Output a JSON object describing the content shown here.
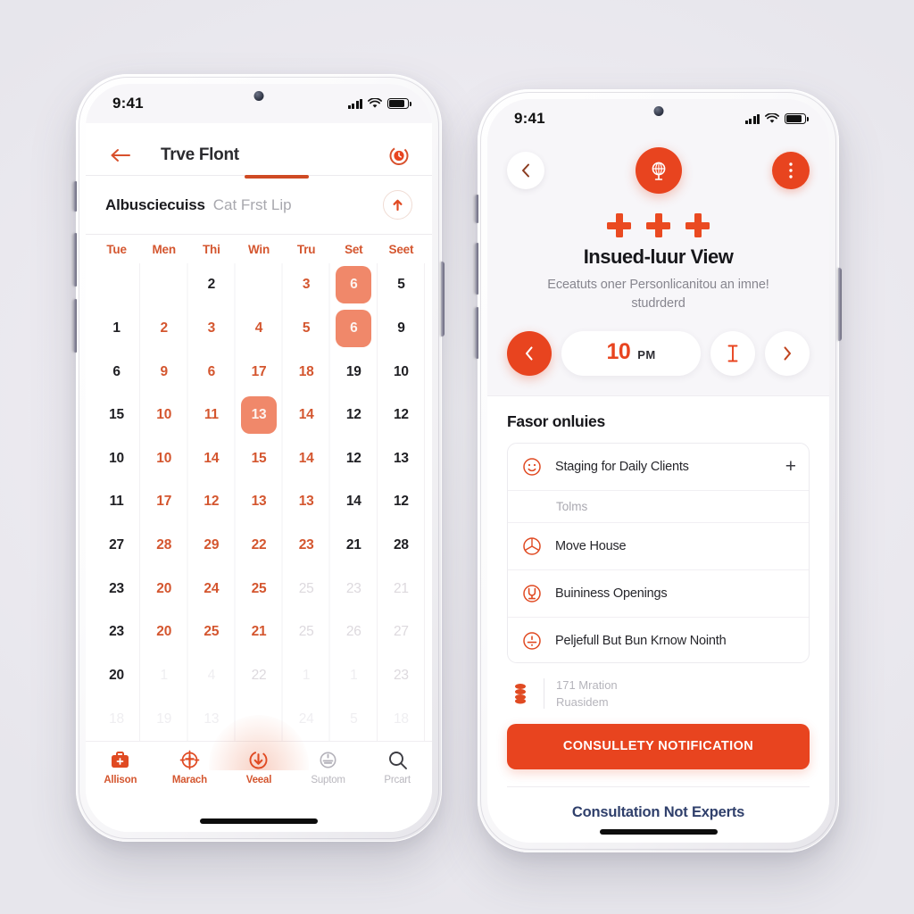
{
  "theme": {
    "brand_orange": "#e8441f",
    "brand_dark": "#d4562f",
    "highlight_salmon": "#f0886a",
    "page_background": "#edecf1",
    "link_blue": "#2f3f6b"
  },
  "left_phone": {
    "status_bar": {
      "time": "9:41",
      "signal_icon": "cellular-signal-icon",
      "wifi_icon": "wifi-icon",
      "battery_icon": "battery-icon"
    },
    "app_bar": {
      "back_icon": "back-arrow-icon",
      "title": "Trve Flont",
      "action_icon": "timer-badge-icon"
    },
    "sub_bar": {
      "title_strong": "Albusciecuiss",
      "title_muted": "Cat Frst Lip",
      "action_icon": "upload-arrow-icon"
    },
    "calendar": {
      "weekdays": [
        "Tue",
        "Men",
        "Thi",
        "Win",
        "Tru",
        "Set",
        "Seet"
      ],
      "rows": [
        [
          {
            "label": "",
            "style": "blank"
          },
          {
            "label": "",
            "style": "blank"
          },
          {
            "label": "2",
            "style": "normal"
          },
          {
            "label": "",
            "style": "blank"
          },
          {
            "label": "3",
            "style": "accent"
          },
          {
            "label": "6",
            "style": "selected"
          },
          {
            "label": "5",
            "style": "normal"
          }
        ],
        [
          {
            "label": "1",
            "style": "normal"
          },
          {
            "label": "2",
            "style": "accent"
          },
          {
            "label": "3",
            "style": "accent"
          },
          {
            "label": "4",
            "style": "accent"
          },
          {
            "label": "5",
            "style": "accent"
          },
          {
            "label": "6",
            "style": "selected"
          },
          {
            "label": "9",
            "style": "normal"
          }
        ],
        [
          {
            "label": "6",
            "style": "normal"
          },
          {
            "label": "9",
            "style": "accent"
          },
          {
            "label": "6",
            "style": "accent"
          },
          {
            "label": "17",
            "style": "accent"
          },
          {
            "label": "18",
            "style": "accent"
          },
          {
            "label": "19",
            "style": "normal"
          },
          {
            "label": "10",
            "style": "normal"
          }
        ],
        [
          {
            "label": "15",
            "style": "normal"
          },
          {
            "label": "10",
            "style": "accent"
          },
          {
            "label": "11",
            "style": "accent"
          },
          {
            "label": "13",
            "style": "selected"
          },
          {
            "label": "14",
            "style": "accent"
          },
          {
            "label": "12",
            "style": "normal"
          },
          {
            "label": "12",
            "style": "normal"
          }
        ],
        [
          {
            "label": "10",
            "style": "normal"
          },
          {
            "label": "10",
            "style": "accent"
          },
          {
            "label": "14",
            "style": "accent"
          },
          {
            "label": "15",
            "style": "accent"
          },
          {
            "label": "14",
            "style": "accent"
          },
          {
            "label": "12",
            "style": "normal"
          },
          {
            "label": "13",
            "style": "normal"
          }
        ],
        [
          {
            "label": "11",
            "style": "normal"
          },
          {
            "label": "17",
            "style": "accent"
          },
          {
            "label": "12",
            "style": "accent"
          },
          {
            "label": "13",
            "style": "accent"
          },
          {
            "label": "13",
            "style": "accent"
          },
          {
            "label": "14",
            "style": "normal"
          },
          {
            "label": "12",
            "style": "normal"
          }
        ],
        [
          {
            "label": "27",
            "style": "normal"
          },
          {
            "label": "28",
            "style": "accent"
          },
          {
            "label": "29",
            "style": "accent"
          },
          {
            "label": "22",
            "style": "accent"
          },
          {
            "label": "23",
            "style": "accent"
          },
          {
            "label": "21",
            "style": "normal"
          },
          {
            "label": "28",
            "style": "normal"
          }
        ],
        [
          {
            "label": "23",
            "style": "normal"
          },
          {
            "label": "20",
            "style": "accent"
          },
          {
            "label": "24",
            "style": "accent"
          },
          {
            "label": "25",
            "style": "accent"
          },
          {
            "label": "25",
            "style": "dim"
          },
          {
            "label": "23",
            "style": "dim"
          },
          {
            "label": "21",
            "style": "dim"
          }
        ],
        [
          {
            "label": "23",
            "style": "normal"
          },
          {
            "label": "20",
            "style": "accent"
          },
          {
            "label": "25",
            "style": "accent"
          },
          {
            "label": "21",
            "style": "accent"
          },
          {
            "label": "25",
            "style": "dim"
          },
          {
            "label": "26",
            "style": "dim"
          },
          {
            "label": "27",
            "style": "dim"
          }
        ],
        [
          {
            "label": "20",
            "style": "normal"
          },
          {
            "label": "1",
            "style": "faint"
          },
          {
            "label": "4",
            "style": "faint"
          },
          {
            "label": "22",
            "style": "dim"
          },
          {
            "label": "1",
            "style": "faint"
          },
          {
            "label": "1",
            "style": "faint"
          },
          {
            "label": "23",
            "style": "dim"
          }
        ],
        [
          {
            "label": "18",
            "style": "faint"
          },
          {
            "label": "19",
            "style": "faint"
          },
          {
            "label": "13",
            "style": "faint"
          },
          {
            "label": "",
            "style": "blank"
          },
          {
            "label": "24",
            "style": "faint"
          },
          {
            "label": "5",
            "style": "faint"
          },
          {
            "label": "18",
            "style": "faint"
          }
        ]
      ]
    },
    "tab_bar": [
      {
        "label": "Allison",
        "icon": "briefcase-icon",
        "active": true
      },
      {
        "label": "Marach",
        "icon": "target-crosshair-icon",
        "active": true
      },
      {
        "label": "Veeal",
        "icon": "download-circle-icon",
        "active": true
      },
      {
        "label": "Suptom",
        "icon": "support-circle-icon",
        "active": false
      },
      {
        "label": "Prcart",
        "icon": "search-icon",
        "active": false
      }
    ]
  },
  "right_phone": {
    "status_bar": {
      "time": "9:41",
      "signal_icon": "cellular-signal-icon",
      "wifi_icon": "wifi-icon",
      "battery_icon": "battery-icon"
    },
    "nav": {
      "back_icon": "chevron-left-icon",
      "logo_icon": "brand-globe-icon",
      "more_icon": "more-vertical-icon"
    },
    "hero": {
      "marks": [
        "plus-mark-icon",
        "plus-mark-icon",
        "plus-mark-icon"
      ],
      "title": "Insued-luur View",
      "subtitle": "Eceatuts oner Personlicanitou an imne! studrderd"
    },
    "stepper": {
      "prev_icon": "chevron-left-icon",
      "value": "10",
      "meridiem": "PM",
      "cursor_icon": "text-cursor-icon",
      "next_icon": "chevron-right-icon"
    },
    "section": {
      "title": "Fasor onluies",
      "rows": [
        {
          "icon": "smiley-face-icon",
          "label": "Staging for Daily Clients",
          "trailing": "+"
        },
        {
          "icon": "",
          "label": "Tolms",
          "type": "subheader"
        },
        {
          "icon": "pie-circle-icon",
          "label": "Move House"
        },
        {
          "icon": "stamp-circle-icon",
          "label": "Buininess Openings"
        },
        {
          "icon": "divide-circle-icon",
          "label": "Peljefull But Bun Krnow Nointh"
        }
      ]
    },
    "note": {
      "icon": "stacked-coins-icon",
      "line1": "171 Mration",
      "line2": "Ruasidem"
    },
    "cta_button": "CONSULLETY NOTIFICATION",
    "footer_link": "Consultation Not Experts"
  }
}
